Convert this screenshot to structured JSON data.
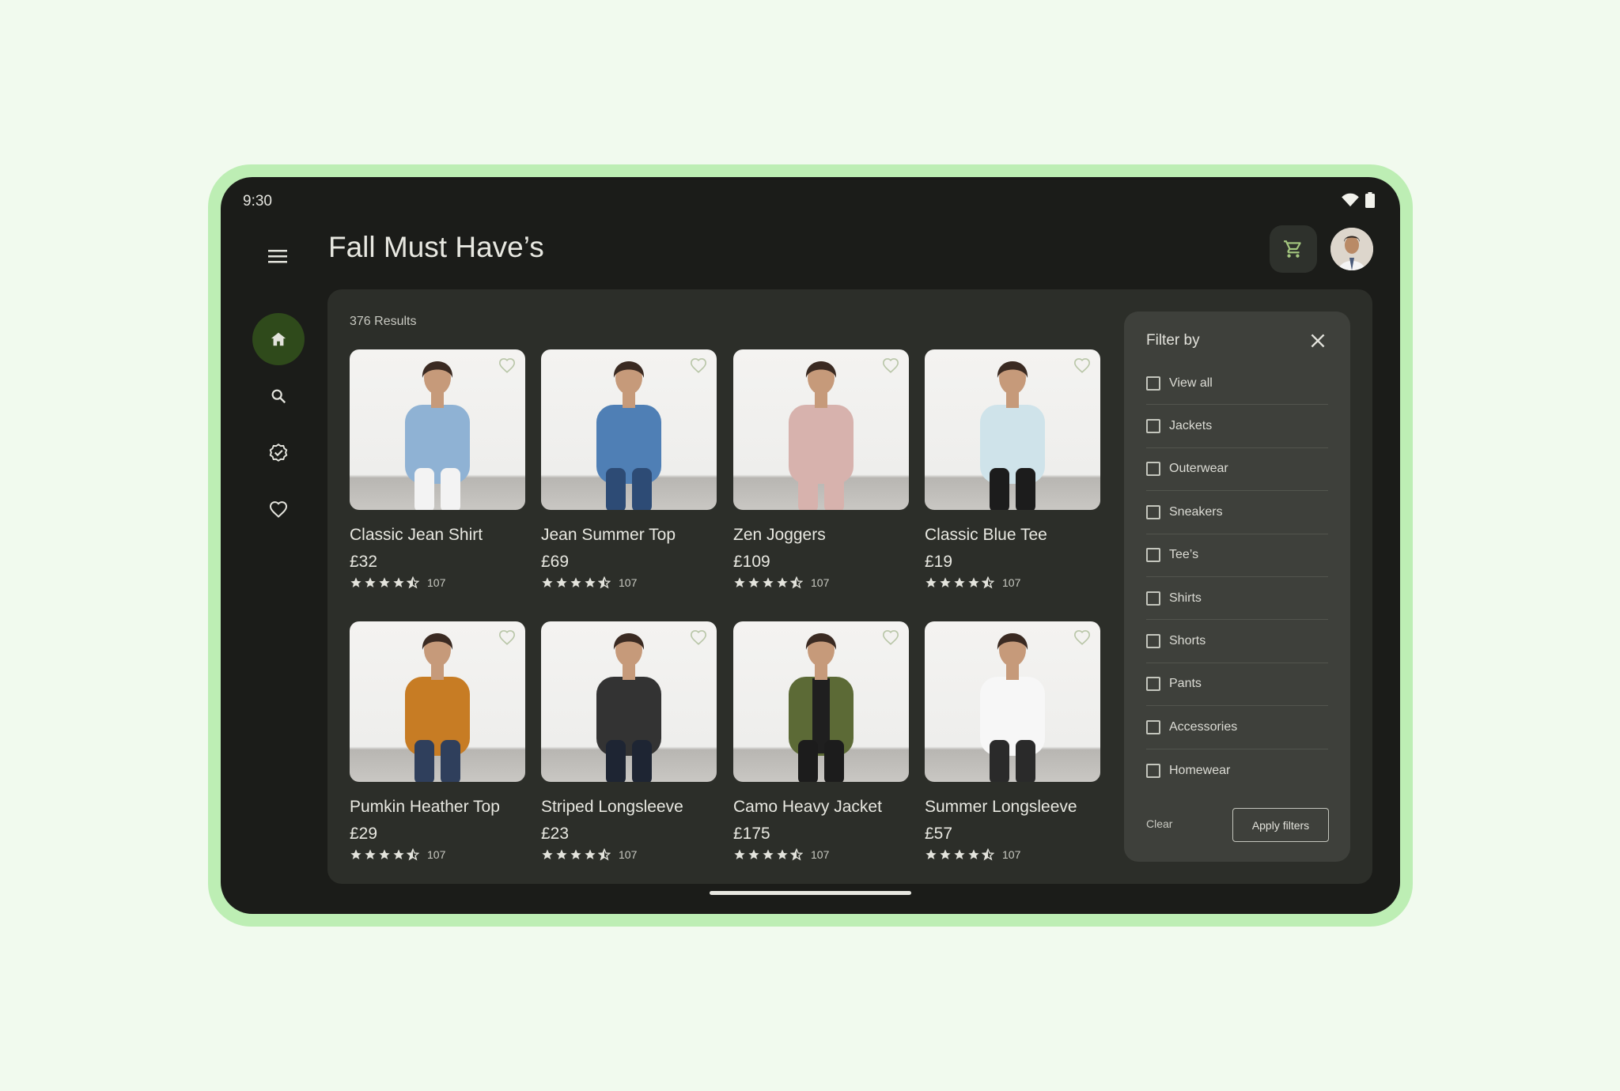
{
  "status": {
    "time": "9:30"
  },
  "header": {
    "title": "Fall Must Have’s"
  },
  "icons": {
    "menu": "menu-icon",
    "cart": "cart-icon",
    "avatar": "avatar",
    "rail": [
      "home-icon",
      "search-icon",
      "verified-icon",
      "favorite-icon"
    ],
    "accent": "#2f4a1b",
    "highlight": "#a4c77f"
  },
  "results": {
    "label": "376 Results"
  },
  "products": [
    {
      "name": "Classic Jean Shirt",
      "price": "£32",
      "reviews": "107",
      "rating": 4.5,
      "color": "#8fb2d4",
      "pants": "#f3f3f3"
    },
    {
      "name": "Jean Summer Top",
      "price": "£69",
      "reviews": "107",
      "rating": 4.5,
      "color": "#4f7fb5",
      "pants": "#2d4b75"
    },
    {
      "name": "Zen Joggers",
      "price": "£109",
      "reviews": "107",
      "rating": 4.5,
      "color": "#d7b2ad",
      "pants": "#d7b2ad"
    },
    {
      "name": "Classic Blue Tee",
      "price": "£19",
      "reviews": "107",
      "rating": 4.5,
      "color": "#cfe3ea",
      "pants": "#1c1c1c"
    },
    {
      "name": "Pumkin Heather Top",
      "price": "£29",
      "reviews": "107",
      "rating": 4.5,
      "color": "#c77c24",
      "pants": "#2f3f5c"
    },
    {
      "name": "Striped Longsleeve",
      "price": "£23",
      "reviews": "107",
      "rating": 4.5,
      "color": "#333333",
      "pants": "#1e2533"
    },
    {
      "name": "Camo Heavy Jacket",
      "price": "£175",
      "reviews": "107",
      "rating": 4.5,
      "color": "#5c6a36",
      "pants": "#1c1c1c"
    },
    {
      "name": "Summer Longsleeve",
      "price": "£57",
      "reviews": "107",
      "rating": 4.5,
      "color": "#f7f7f7",
      "pants": "#2a2a2a"
    }
  ],
  "filter": {
    "title": "Filter by",
    "options": [
      "View all",
      "Jackets",
      "Outerwear",
      "Sneakers",
      "Tee’s",
      "Shirts",
      "Shorts",
      "Pants",
      "Accessories",
      "Homewear"
    ],
    "clear_label": "Clear",
    "apply_label": "Apply filters"
  }
}
